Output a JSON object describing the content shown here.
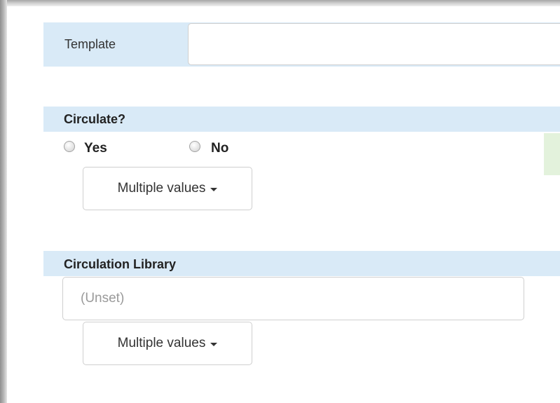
{
  "template": {
    "label": "Template",
    "value": ""
  },
  "circulate": {
    "title": "Circulate?",
    "options": [
      {
        "label": "Yes",
        "selected": false
      },
      {
        "label": "No",
        "selected": false
      }
    ],
    "multi_button": "Multiple values"
  },
  "circulation_library": {
    "title": "Circulation Library",
    "value": "(Unset)",
    "multi_button": "Multiple values"
  },
  "colors": {
    "label_bg": "#d9eaf7",
    "hint_green": "#e3f2dc",
    "input_border": "#cfcfcf"
  },
  "icons": {
    "dropdown_caret": "caret-down-icon"
  }
}
